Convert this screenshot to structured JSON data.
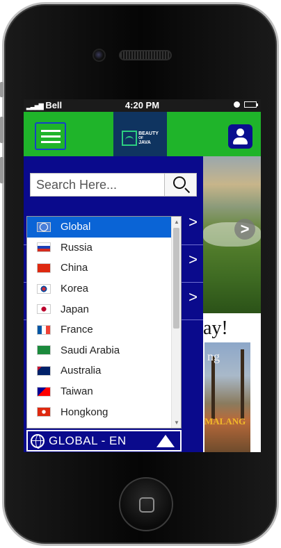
{
  "statusbar": {
    "carrier": "Bell",
    "time": "4:20 PM"
  },
  "header": {
    "logo_title": "BEAUTY",
    "logo_sub": "JAVA",
    "logo_of": "OF",
    "logo_tm": "TM"
  },
  "search": {
    "placeholder": "Search Here..."
  },
  "background": {
    "partial_heading": "ay!",
    "partial_text": "ng",
    "sign_text": "MALANG"
  },
  "languages": [
    {
      "label": "Global",
      "selected": true,
      "flag": "globe-flag"
    },
    {
      "label": "Russia",
      "selected": false,
      "flag": "russia-flag"
    },
    {
      "label": "China",
      "selected": false,
      "flag": "china-flag"
    },
    {
      "label": "Korea",
      "selected": false,
      "flag": "korea-flag"
    },
    {
      "label": "Japan",
      "selected": false,
      "flag": "japan-flag"
    },
    {
      "label": "France",
      "selected": false,
      "flag": "france-flag"
    },
    {
      "label": "Saudi Arabia",
      "selected": false,
      "flag": "saudi-flag"
    },
    {
      "label": "Australia",
      "selected": false,
      "flag": "australia-flag"
    },
    {
      "label": "Taiwan",
      "selected": false,
      "flag": "taiwan-flag"
    },
    {
      "label": "Hongkong",
      "selected": false,
      "flag": "hongkong-flag"
    }
  ],
  "language_bar": {
    "label": "GLOBAL  -  EN"
  },
  "colors": {
    "appbar": "#1fb42a",
    "drawer": "#0a0a8c",
    "selected": "#0a64d6",
    "logo_bg": "#0f3460"
  }
}
